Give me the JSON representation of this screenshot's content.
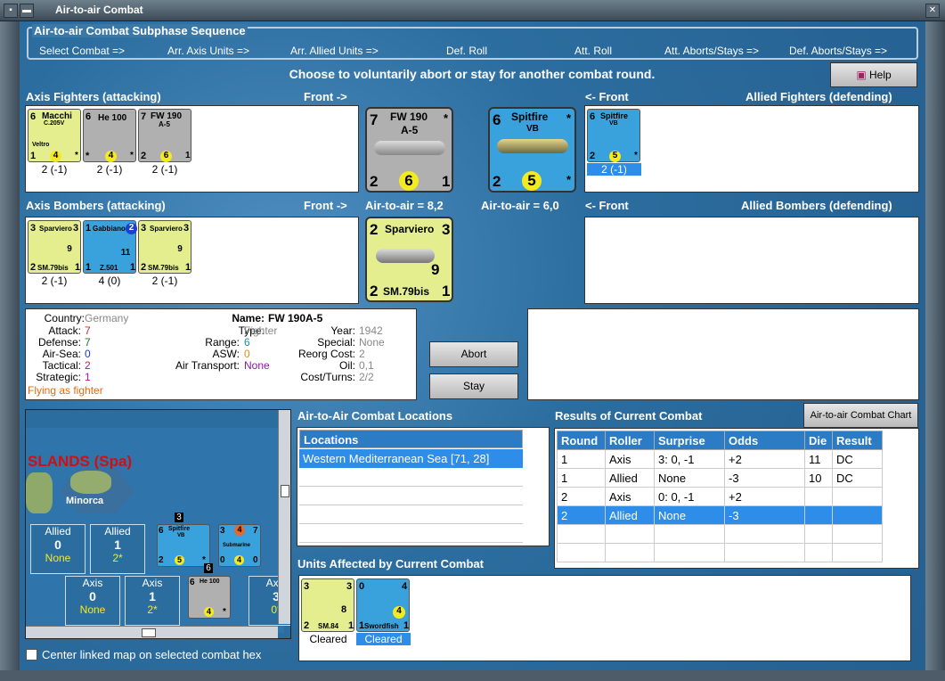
{
  "window": {
    "title": "Air-to-air Combat"
  },
  "sequence": {
    "title": "Air-to-air Combat Subphase Sequence",
    "steps": [
      "Select Combat =>",
      "Arr. Axis Units =>",
      "Arr. Allied Units =>",
      "Def. Roll",
      "Att. Roll",
      "Att. Aborts/Stays =>",
      "Def. Aborts/Stays =>"
    ]
  },
  "instruction": "Choose to voluntarily abort or stay for another combat round.",
  "help_label": "Help",
  "sections": {
    "axis_fighters": "Axis Fighters (attacking)",
    "front_right": "Front ->",
    "front_left": "<- Front",
    "allied_fighters": "Allied Fighters (defending)",
    "axis_bombers": "Axis Bombers (attacking)",
    "allied_bombers": "Allied Bombers (defending)"
  },
  "axis_fighters": [
    {
      "name": "Macchi",
      "model": "C.205V",
      "sub": "Veltro",
      "left": "6",
      "bl": "1",
      "num": "4",
      "br": "*",
      "val": "2 (-1)"
    },
    {
      "name": "He 100",
      "model": "",
      "sub": "",
      "left": "6",
      "bl": "*",
      "num": "4",
      "br": "*",
      "val": "2 (-1)"
    },
    {
      "name": "FW 190",
      "model": "A-5",
      "sub": "",
      "left": "7",
      "bl": "2",
      "num": "6",
      "br": "1",
      "val": "2 (-1)"
    }
  ],
  "allied_fighters": [
    {
      "name": "Spitfire",
      "model": "VB",
      "left": "6",
      "bl": "2",
      "num": "5",
      "br": "*",
      "val": "2 (-1)"
    }
  ],
  "axis_bombers": [
    {
      "name": "Sparviero",
      "model": "SM.79bis",
      "tl": "3",
      "tr": "3",
      "bl": "2",
      "br": "1",
      "num": "9",
      "val": "2 (-1)"
    },
    {
      "name": "Gabbiano",
      "model": "Z.501",
      "tl": "1",
      "tr": "2",
      "bl": "1",
      "br": "1",
      "num": "11",
      "val": "4 (0)"
    },
    {
      "name": "Sparviero",
      "model": "SM.79bis",
      "tl": "3",
      "tr": "3",
      "bl": "2",
      "br": "1",
      "num": "9",
      "val": "2 (-1)"
    }
  ],
  "big_axis_fighter": {
    "name": "FW 190",
    "model": "A-5",
    "left": "7",
    "star": "*",
    "bl": "2",
    "num": "6",
    "br": "1"
  },
  "big_allied_fighter": {
    "name": "Spitfire",
    "model": "VB",
    "left": "6",
    "star": "*",
    "bl": "2",
    "num": "5",
    "br": "*"
  },
  "big_axis_bomber": {
    "name": "Sparviero",
    "model": "SM.79bis",
    "tl": "2",
    "tr": "3",
    "bl": "2",
    "br": "1",
    "num": "9"
  },
  "air_to_air_axis": "Air-to-air = 8,2",
  "air_to_air_allied": "Air-to-air = 6,0",
  "unit_info": {
    "country_k": "Country:",
    "country_v": "Germany",
    "attack_k": "Attack:",
    "attack_v": "7",
    "defense_k": "Defense:",
    "defense_v": "7",
    "airsea_k": "Air-Sea:",
    "airsea_v": "0",
    "tactical_k": "Tactical:",
    "tactical_v": "2",
    "strategic_k": "Strategic:",
    "strategic_v": "1",
    "flying": "Flying as fighter",
    "name_k": "Name:",
    "name_v": "FW 190A-5",
    "type_k": "Type:",
    "type_v": "Fighter",
    "range_k": "Range:",
    "range_v": "6",
    "asw_k": "ASW:",
    "asw_v": "0",
    "transport_k": "Air Transport:",
    "transport_v": "None",
    "year_k": "Year:",
    "year_v": "1942",
    "special_k": "Special:",
    "special_v": "None",
    "reorg_k": "Reorg Cost:",
    "reorg_v": "2",
    "oil_k": "Oil:",
    "oil_v": "0,1",
    "cost_k": "Cost/Turns:",
    "cost_v": "2/2"
  },
  "abort_label": "Abort",
  "stay_label": "Stay",
  "map": {
    "sea": "SLANDS (Spa)",
    "island": "Minorca",
    "allied_boxes": [
      {
        "title": "Allied",
        "n": "0",
        "s": "None"
      },
      {
        "title": "Allied",
        "n": "1",
        "s": "2*"
      }
    ],
    "axis_boxes": [
      {
        "title": "Axis",
        "n": "0",
        "s": "None"
      },
      {
        "title": "Axis",
        "n": "1",
        "s": "2*"
      },
      {
        "title": "Axis",
        "n": "3",
        "s": "0*"
      }
    ],
    "stack_count_1": "3",
    "stack_count_2": "6",
    "spit": {
      "name": "Spitfire",
      "model": "VB",
      "l": "6",
      "bl": "2",
      "num": "5",
      "br": "*"
    },
    "sub": {
      "name": "Submarine",
      "tl": "3",
      "num_top": "4",
      "tr": "7",
      "bl": "0",
      "num": "4",
      "br": "0"
    },
    "he": {
      "name": "He 100",
      "l": "6",
      "num": "4",
      "br": "*"
    }
  },
  "center_map_label": "Center linked map on selected combat hex",
  "locations": {
    "title": "Air-to-Air Combat Locations",
    "header": "Locations",
    "items": [
      "Western Mediterranean Sea [71, 28]"
    ]
  },
  "results": {
    "title": "Results of Current Combat",
    "chart_button": "Air-to-air Combat Chart",
    "headers": [
      "Round",
      "Roller",
      "Surprise",
      "Odds",
      "Die",
      "Result"
    ],
    "rows": [
      [
        "1",
        "Axis",
        "3: 0, -1",
        "+2",
        "11",
        "DC"
      ],
      [
        "1",
        "Allied",
        "None",
        "-3",
        "10",
        "DC"
      ],
      [
        "2",
        "Axis",
        "0: 0, -1",
        "+2",
        "",
        ""
      ],
      [
        "2",
        "Allied",
        "None",
        "-3",
        "",
        ""
      ]
    ]
  },
  "affected": {
    "title": "Units Affected by Current Combat",
    "units": [
      {
        "name": "SM.84",
        "tl": "3",
        "tr": "3",
        "bl": "2",
        "br": "1",
        "num": "8",
        "status": "Cleared"
      },
      {
        "name": "Swordfish",
        "tl": "0",
        "tr": "4",
        "bl": "1",
        "br": "1",
        "num": "4",
        "status": "Cleared"
      }
    ]
  },
  "colors": {
    "axis_counter": "#e4ee8e",
    "german_counter": "#b0b0b0",
    "allied_counter": "#39a2dc",
    "selected": "#2e8de8"
  }
}
